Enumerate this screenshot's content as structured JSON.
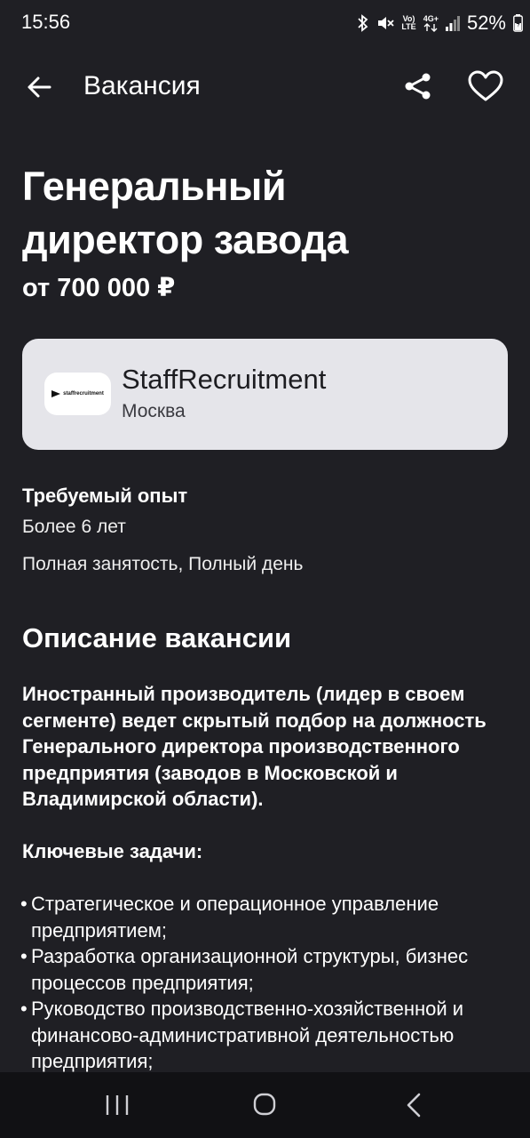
{
  "status_bar": {
    "time": "15:56",
    "lte_label_top": "Vo)",
    "lte_label_bottom": "LTE",
    "net_label": "4G+",
    "battery": "52%",
    "icons": [
      "bluetooth-icon",
      "mute-icon",
      "volte-icon",
      "4g-icon",
      "signal-icon",
      "battery-icon"
    ]
  },
  "app_bar": {
    "title": "Вакансия",
    "icons": [
      "back-arrow-icon",
      "share-icon",
      "heart-icon"
    ]
  },
  "vacancy": {
    "title_line1": "Генеральный",
    "title_line2": "директор завода",
    "salary": "от 700 000 ₽"
  },
  "company": {
    "logo_text": "staffrecruitment",
    "name": "StaffRecruitment",
    "city": "Москва"
  },
  "details": {
    "experience_label": "Требуемый опыт",
    "experience_value": "Более 6 лет",
    "employment": "Полная занятость, Полный день"
  },
  "description": {
    "heading": "Описание вакансии",
    "intro": "Иностранный производитель (лидер в своем сегменте) ведет скрытый подбор на должность Генерального директора производственного предприятия (заводов в Московской и Владимирской области).",
    "tasks_heading": "Ключевые задачи:",
    "bullet": "•",
    "tasks": [
      "Стратегическое и операционное управление предприятием;",
      "Разработка организационной структуры, бизнес процессов предприятия;",
      "Руководство производственно-хозяйственной и финансово-административной деятельностью предприятия;"
    ]
  },
  "nav_bar": {
    "icons": [
      "recents-icon",
      "home-icon",
      "back-icon"
    ]
  },
  "colors": {
    "background": "#1f1f24",
    "card": "#e5e5ea",
    "nav": "#111114",
    "text": "#ffffff"
  }
}
